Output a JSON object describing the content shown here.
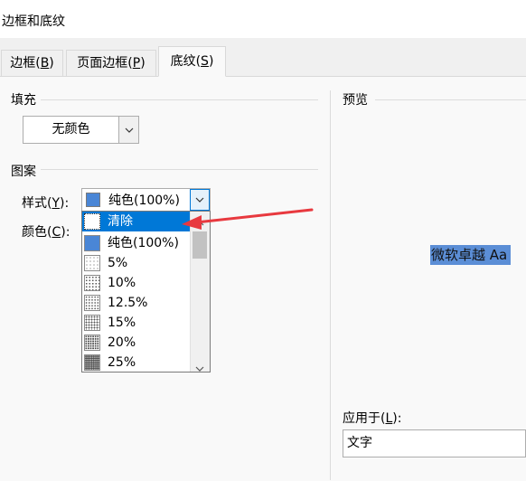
{
  "window": {
    "title": "边框和底纹"
  },
  "tabs": [
    {
      "label": "边框(",
      "key": "B",
      "suffix": ")"
    },
    {
      "label": "页面边框(",
      "key": "P",
      "suffix": ")"
    },
    {
      "label": "底纹(",
      "key": "S",
      "suffix": ")"
    }
  ],
  "fill": {
    "section_label": "填充",
    "value": "无颜色"
  },
  "pattern": {
    "section_label": "图案",
    "style_label": "样式(",
    "style_key": "Y",
    "style_suffix": "):",
    "style_value": "纯色(100%)",
    "color_label": "颜色(",
    "color_key": "C",
    "color_suffix": "):"
  },
  "dropdown": {
    "items": [
      "清除",
      "纯色(100%)",
      "5%",
      "10%",
      "12.5%",
      "15%",
      "20%",
      "25%"
    ],
    "selected": "清除"
  },
  "preview": {
    "section_label": "预览",
    "sample_text": "微软卓越  Aa"
  },
  "apply_to": {
    "label": "应用于(",
    "key": "L",
    "suffix": "):",
    "value": "文字"
  },
  "colors": {
    "accent": "#0078d7",
    "solid_swatch": "#4a86d6",
    "preview_highlight": "#5b8ed6",
    "annotation_arrow": "#e8393f"
  }
}
